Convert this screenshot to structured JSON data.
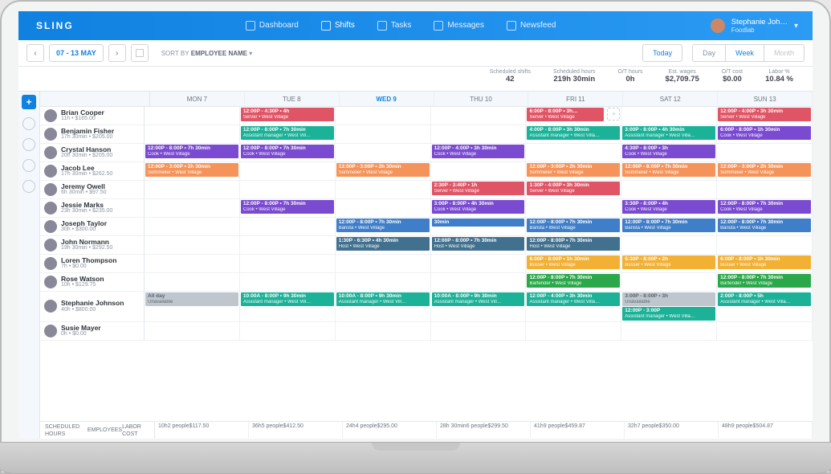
{
  "app": {
    "logo": "SLING"
  },
  "nav": [
    {
      "label": "Dashboard",
      "icon": "dashboard-icon",
      "active": false
    },
    {
      "label": "Shifts",
      "icon": "shifts-icon",
      "active": true
    },
    {
      "label": "Tasks",
      "icon": "tasks-icon",
      "active": false
    },
    {
      "label": "Messages",
      "icon": "messages-icon",
      "active": false
    },
    {
      "label": "Newsfeed",
      "icon": "newsfeed-icon",
      "active": false
    }
  ],
  "user": {
    "name": "Stephanie Joh…",
    "org": "Foodlab"
  },
  "toolbar": {
    "prev": "‹",
    "next": "›",
    "range": "07 - 13 MAY",
    "sort_label": "SORT BY",
    "sort_value": "EMPLOYEE NAME",
    "today": "Today",
    "views": [
      "Day",
      "Week",
      "Month"
    ],
    "active_view": "Week"
  },
  "stats": [
    {
      "label": "Scheduled shifts",
      "value": "42"
    },
    {
      "label": "Scheduled hours",
      "value": "219h 30min"
    },
    {
      "label": "O/T hours",
      "value": "0h"
    },
    {
      "label": "Est. wages",
      "value": "$2,709.75"
    },
    {
      "label": "O/T cost",
      "value": "$0.00"
    },
    {
      "label": "Labor %",
      "value": "10.84 %"
    }
  ],
  "days": [
    "MON 7",
    "TUE 8",
    "WED 9",
    "THU 10",
    "FRI 11",
    "SAT 12",
    "SUN 13"
  ],
  "active_day_index": 2,
  "employees": [
    {
      "name": "Brian Cooper",
      "sub": "11h • $165.00",
      "shifts": {
        "1": [
          {
            "c": "red",
            "t": "12:00P - 4:30P • 4h",
            "r": "Server • West Village"
          }
        ],
        "4": [
          {
            "c": "red",
            "t": "6:00P - 8:00P • 3h…",
            "r": "Server • West Village"
          }
        ],
        "6": [
          {
            "c": "red",
            "t": "12:00P - 4:00P • 3h 30min",
            "r": "Server • West Village"
          }
        ]
      },
      "addSlot": 4
    },
    {
      "name": "Benjamin Fisher",
      "sub": "17h 30min • $205.00",
      "shifts": {
        "1": [
          {
            "c": "teal",
            "t": "12:00P - 8:00P • 7h 30min",
            "r": "Assistant manager • West Vill…"
          }
        ],
        "4": [
          {
            "c": "teal",
            "t": "4:00P - 8:00P • 3h 30min",
            "r": "Assistant manager • West Villa…"
          }
        ],
        "5": [
          {
            "c": "teal",
            "t": "3:00P - 8:00P • 4h 30min",
            "r": "Assistant manager • West Villa…"
          }
        ],
        "6": [
          {
            "c": "purple",
            "t": "6:00P - 8:00P • 1h 30min",
            "r": "Cook • West Village"
          }
        ]
      }
    },
    {
      "name": "Crystal Hanson",
      "sub": "20h 30min • $205.00",
      "shifts": {
        "0": [
          {
            "c": "purple",
            "t": "12:00P - 8:00P • 7h 30min",
            "r": "Cook • West Village"
          }
        ],
        "1": [
          {
            "c": "purple",
            "t": "12:00P - 8:00P • 7h 30min",
            "r": "Cook • West Village"
          }
        ],
        "3": [
          {
            "c": "purple",
            "t": "12:00P - 4:00P • 3h 30min",
            "r": "Cook • West Village"
          }
        ],
        "5": [
          {
            "c": "purple",
            "t": "4:30P - 8:00P • 3h",
            "r": "Cook • West Village"
          }
        ]
      }
    },
    {
      "name": "Jacob Lee",
      "sub": "17h 30min • $262.50",
      "shifts": {
        "0": [
          {
            "c": "orange",
            "t": "12:00P - 3:00P • 2h 30min",
            "r": "Sommelier • West Village"
          }
        ],
        "2": [
          {
            "c": "orange",
            "t": "12:00P - 3:00P • 2h 30min",
            "r": "Sommelier • West Village"
          }
        ],
        "4": [
          {
            "c": "orange",
            "t": "12:00P - 3:00P • 2h 30min",
            "r": "Sommelier • West Village"
          }
        ],
        "5": [
          {
            "c": "orange",
            "t": "12:00P - 8:00P • 7h 30min",
            "r": "Sommelier • West Village"
          }
        ],
        "6": [
          {
            "c": "orange",
            "t": "12:00P - 3:00P • 2h 30min",
            "r": "Sommelier • West Village"
          }
        ]
      }
    },
    {
      "name": "Jeremy Owell",
      "sub": "6h 30min • $97.50",
      "shifts": {
        "3": [
          {
            "c": "red",
            "t": "2:30P - 3:40P • 1h",
            "r": "Server • West Village"
          }
        ],
        "4": [
          {
            "c": "red",
            "t": "1:30P - 4:00P • 3h 30min",
            "r": "Server • West Village"
          }
        ]
      }
    },
    {
      "name": "Jessie Marks",
      "sub": "23h 30min • $235.00",
      "shifts": {
        "1": [
          {
            "c": "purple",
            "t": "12:00P - 8:00P • 7h 30min",
            "r": "Cook • West Village"
          }
        ],
        "3": [
          {
            "c": "purple",
            "t": "3:00P - 8:00P • 4h 30min",
            "r": "Cook • West Village"
          }
        ],
        "5": [
          {
            "c": "purple",
            "t": "3:30P - 8:00P • 4h",
            "r": "Cook • West Village"
          }
        ],
        "6": [
          {
            "c": "purple",
            "t": "12:00P - 8:00P • 7h 30min",
            "r": "Cook • West Village"
          }
        ]
      }
    },
    {
      "name": "Joseph Taylor",
      "sub": "30h • $300.00",
      "shifts": {
        "2": [
          {
            "c": "blue",
            "t": "12:00P - 8:00P • 7h 30min",
            "r": "Barista • West Village"
          }
        ],
        "3": [
          {
            "c": "blue",
            "t": "30min"
          }
        ],
        "4": [
          {
            "c": "blue",
            "t": "12:00P - 8:00P • 7h 30min",
            "r": "Barista • West Village"
          }
        ],
        "5": [
          {
            "c": "blue",
            "t": "12:00P - 8:00P • 7h 30min",
            "r": "Barista • West Village"
          }
        ],
        "6": [
          {
            "c": "blue",
            "t": "12:00P - 8:00P • 7h 30min",
            "r": "Barista • West Village"
          }
        ]
      }
    },
    {
      "name": "John Normann",
      "sub": "19h 30min • $292.50",
      "shifts": {
        "2": [
          {
            "c": "steel",
            "t": "1:30P - 6:30P • 4h 30min",
            "r": "Host • West Village"
          }
        ],
        "3": [
          {
            "c": "steel",
            "t": "12:00P - 8:00P • 7h 30min",
            "r": "Host • West Village"
          }
        ],
        "4": [
          {
            "c": "steel",
            "t": "12:00P - 8:00P • 7h 30min",
            "r": "Host • West Village"
          }
        ]
      }
    },
    {
      "name": "Loren Thompson",
      "sub": "7h • $0.00",
      "shifts": {
        "4": [
          {
            "c": "gold",
            "t": "6:00P - 8:00P • 1h 30min",
            "r": "Busser • West Village"
          }
        ],
        "5": [
          {
            "c": "gold",
            "t": "5:30P - 8:00P • 2h",
            "r": "Busser • West Village"
          }
        ],
        "6": [
          {
            "c": "gold",
            "t": "6:00P - 8:00P • 1h 30min",
            "r": "Busser • West Village"
          }
        ]
      }
    },
    {
      "name": "Rose Watson",
      "sub": "10h • $129.75",
      "shifts": {
        "4": [
          {
            "c": "green",
            "t": "12:00P - 8:00P • 7h 30min",
            "r": "Bartender • West Village"
          }
        ],
        "6": [
          {
            "c": "green",
            "t": "12:00P - 8:00P • 7h 30min",
            "r": "Bartender • West Village"
          }
        ]
      }
    },
    {
      "name": "Stephanie Johnson",
      "sub": "40h • $800.00",
      "shifts": {
        "0": [
          {
            "c": "grey",
            "t": "All day",
            "r": "Unavailable"
          }
        ],
        "1": [
          {
            "c": "teal",
            "t": "10:00A - 8:00P • 9h 30min",
            "r": "Assistant manager • West Vill…"
          }
        ],
        "2": [
          {
            "c": "teal",
            "t": "10:00A - 8:00P • 9h 30min",
            "r": "Assistant manager • West Vill…"
          }
        ],
        "3": [
          {
            "c": "teal",
            "t": "10:00A - 8:00P • 9h 30min",
            "r": "Assistant manager • West Vill…"
          }
        ],
        "4": [
          {
            "c": "teal",
            "t": "12:00P - 4:00P • 3h 30min",
            "r": "Assistant manager • West Villa…"
          }
        ],
        "5": [
          {
            "c": "grey",
            "t": "3:00P - 8:00P • 3h",
            "r": "Unavailable"
          },
          {
            "c": "teal",
            "t": "12:00P - 3:00P",
            "r": "Assistant manager • West Villa…"
          }
        ],
        "6": [
          {
            "c": "teal",
            "t": "2:00P - 8:00P • 5h",
            "r": "Assistant manager • West Villa…"
          }
        ]
      }
    },
    {
      "name": "Susie Mayer",
      "sub": "0h • $0.00",
      "shifts": {}
    }
  ],
  "footer": {
    "labels": [
      "SCHEDULED HOURS",
      "EMPLOYEES",
      "LABOR COST"
    ],
    "days": [
      {
        "h": "10h",
        "e": "2 people",
        "c": "$117.50"
      },
      {
        "h": "36h",
        "e": "5 people",
        "c": "$412.50"
      },
      {
        "h": "24h",
        "e": "4 people",
        "c": "$295.00"
      },
      {
        "h": "28h 30min",
        "e": "6 people",
        "c": "$299.50"
      },
      {
        "h": "41h",
        "e": "9 people",
        "c": "$459.87"
      },
      {
        "h": "32h",
        "e": "7 people",
        "c": "$350.00"
      },
      {
        "h": "48h",
        "e": "9 people",
        "c": "$504.87"
      }
    ]
  }
}
